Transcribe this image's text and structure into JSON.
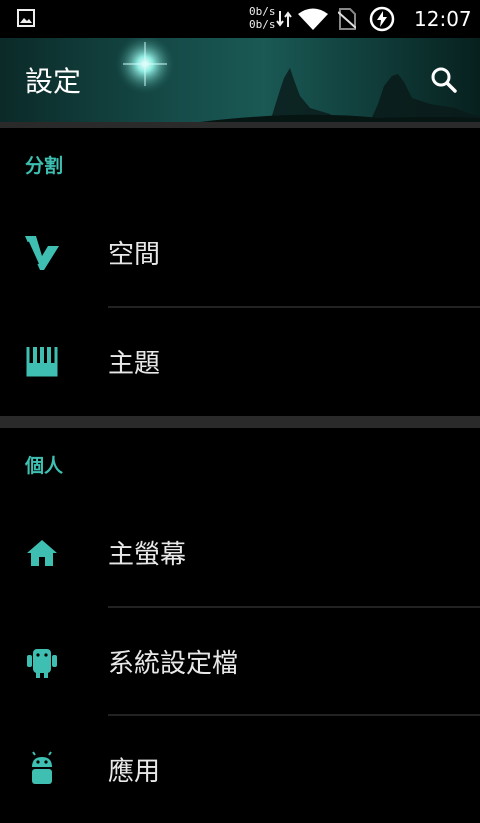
{
  "status_bar": {
    "net_up": "0b/s",
    "net_down": "0b/s",
    "time": "12:07",
    "icons": [
      "image-icon",
      "data-arrows-icon",
      "wifi-icon",
      "no-sim-icon",
      "battery-charging-icon"
    ]
  },
  "toolbar": {
    "title": "設定",
    "search_icon": "search-icon"
  },
  "colors": {
    "accent": "#3fbfb2",
    "background": "#000000",
    "strip": "#2a2a2a"
  },
  "sections": [
    {
      "header": "分割",
      "items": [
        {
          "label": "空間",
          "icon": "space-v-icon"
        },
        {
          "label": "主題",
          "icon": "theme-icon"
        }
      ]
    },
    {
      "header": "個人",
      "items": [
        {
          "label": "主螢幕",
          "icon": "home-icon"
        },
        {
          "label": "系統設定檔",
          "icon": "android-profile-icon"
        },
        {
          "label": "應用",
          "icon": "android-apps-icon"
        }
      ]
    }
  ]
}
